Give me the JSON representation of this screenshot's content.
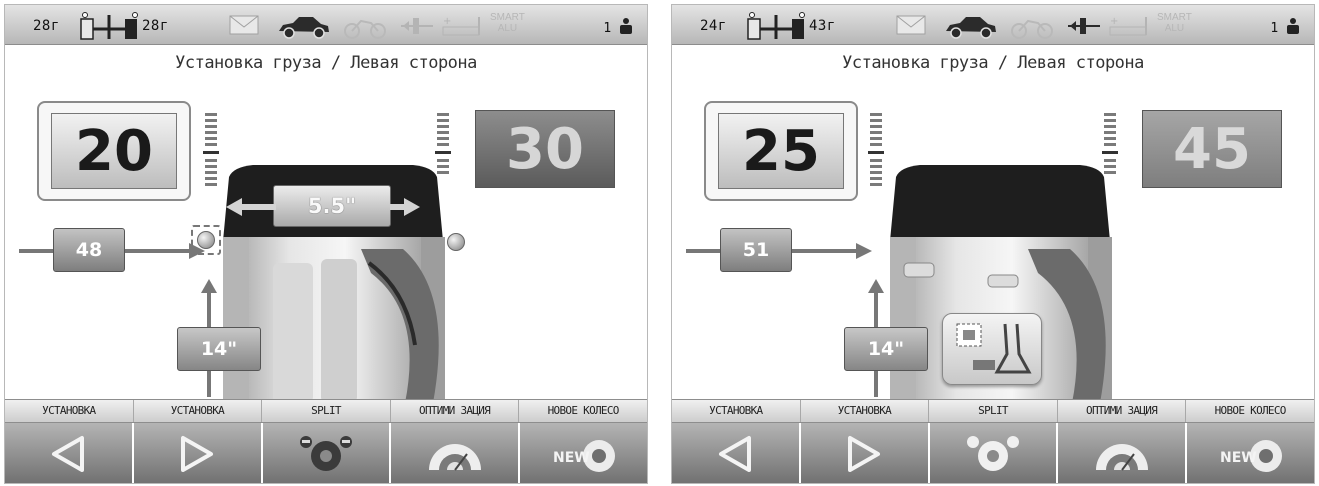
{
  "colors": {
    "screen_bg": "#ffffff",
    "topbar": "#c9c9c9",
    "tire": "#202020",
    "key_gradient_top": "#b4b4b4",
    "key_gradient_bottom": "#6f6f6f"
  },
  "screens": [
    {
      "topbar": {
        "left_weight": "28г",
        "right_weight": "28г",
        "icons": [
          "axle-icon",
          "mail-icon",
          "car-icon",
          "motorcycle-icon",
          "inner-weight-icon",
          "outer-weight-icon"
        ],
        "smart_top": "SMART",
        "smart_bottom": "ALU",
        "operator": "1"
      },
      "title": "Установка груза / Левая сторона",
      "left_weight": "20",
      "right_weight": "30",
      "rim_width": "5.5\"",
      "distance": "48",
      "diameter": "14\"",
      "show_width_badge": true,
      "show_weight_tool": false,
      "function_labels": [
        "УСТАНОВКА",
        "УСТАНОВКА",
        "SPLIT",
        "ОПТИМИ ЗАЦИЯ",
        "НОВОЕ КОЛЕСО"
      ],
      "function_icons": [
        "arrow-left-icon",
        "arrow-right-icon",
        "split-icon",
        "optimization-icon",
        "new-wheel-icon"
      ],
      "new_badge": "NEW"
    },
    {
      "topbar": {
        "left_weight": "24г",
        "right_weight": "43г",
        "icons": [
          "axle-icon",
          "mail-icon",
          "car-icon",
          "motorcycle-icon",
          "inner-weight-icon",
          "outer-weight-icon"
        ],
        "smart_top": "SMART",
        "smart_bottom": "ALU",
        "operator": "1"
      },
      "title": "Установка груза / Левая сторона",
      "left_weight": "25",
      "right_weight": "45",
      "rim_width": "",
      "distance": "51",
      "diameter": "14\"",
      "show_width_badge": false,
      "show_weight_tool": true,
      "function_labels": [
        "УСТАНОВКА",
        "УСТАНОВКА",
        "SPLIT",
        "ОПТИМИ ЗАЦИЯ",
        "НОВОЕ КОЛЕСО"
      ],
      "function_icons": [
        "arrow-left-icon",
        "arrow-right-icon",
        "split-icon",
        "optimization-icon",
        "new-wheel-icon"
      ],
      "new_badge": "NEW"
    }
  ]
}
